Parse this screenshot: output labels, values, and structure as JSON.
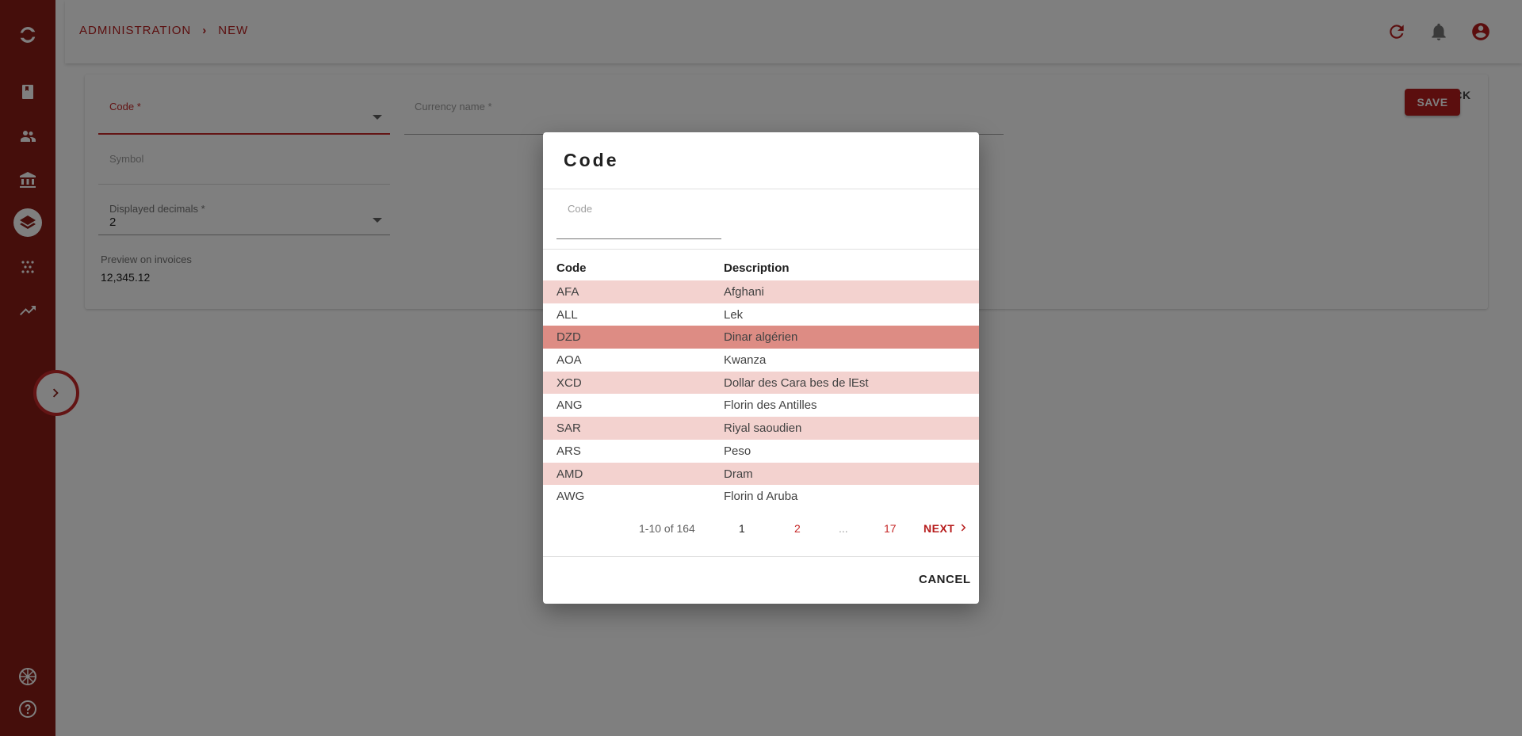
{
  "header": {
    "breadcrumb": [
      "ADMINISTRATION",
      "NEW"
    ],
    "breadcrumb_sep": "›",
    "icons": [
      "refresh-icon",
      "bell-icon",
      "account-icon"
    ]
  },
  "sidebar": {
    "icons": [
      "logo-icon",
      "book-icon",
      "people-icon",
      "bank-icon",
      "layers-icon",
      "dots-grid-icon",
      "trending-up-icon",
      "language-flag-icon",
      "help-icon"
    ],
    "active": "layers-icon",
    "expand": "chevron-right-icon"
  },
  "form": {
    "code_label": "Code *",
    "currency_name_label": "Currency name *",
    "symbol_label": "Symbol",
    "decimals_label": "Displayed decimals *",
    "decimals_value": "2",
    "preview_label": "Preview on invoices",
    "preview_value": "12,345.12",
    "go_back_label": "GO BACK",
    "save_label": "SAVE"
  },
  "dialog": {
    "title": "Code",
    "filter_label": "Code",
    "columns": [
      "Code",
      "Description"
    ],
    "rows": [
      {
        "code": "AFA",
        "desc": "Afghani"
      },
      {
        "code": "ALL",
        "desc": "Lek"
      },
      {
        "code": "DZD",
        "desc": "Dinar algérien"
      },
      {
        "code": "AOA",
        "desc": "Kwanza"
      },
      {
        "code": "XCD",
        "desc": "Dollar des Cara bes de lEst"
      },
      {
        "code": "ANG",
        "desc": "Florin des Antilles"
      },
      {
        "code": "SAR",
        "desc": "Riyal saoudien"
      },
      {
        "code": "ARS",
        "desc": "Peso"
      },
      {
        "code": "AMD",
        "desc": "Dram"
      },
      {
        "code": "AWG",
        "desc": "Florin d Aruba"
      }
    ],
    "selected_row": 2,
    "pager": {
      "info": "1-10 of 164",
      "pages": [
        "1",
        "2",
        "...",
        "17"
      ],
      "current": "1",
      "next_label": "NEXT"
    },
    "cancel_label": "CANCEL"
  },
  "colors": {
    "brand": "#8b1c16",
    "accent": "#b71c1c",
    "row_stripe": "#f3d2cf",
    "row_selected": "#dd8c84"
  }
}
